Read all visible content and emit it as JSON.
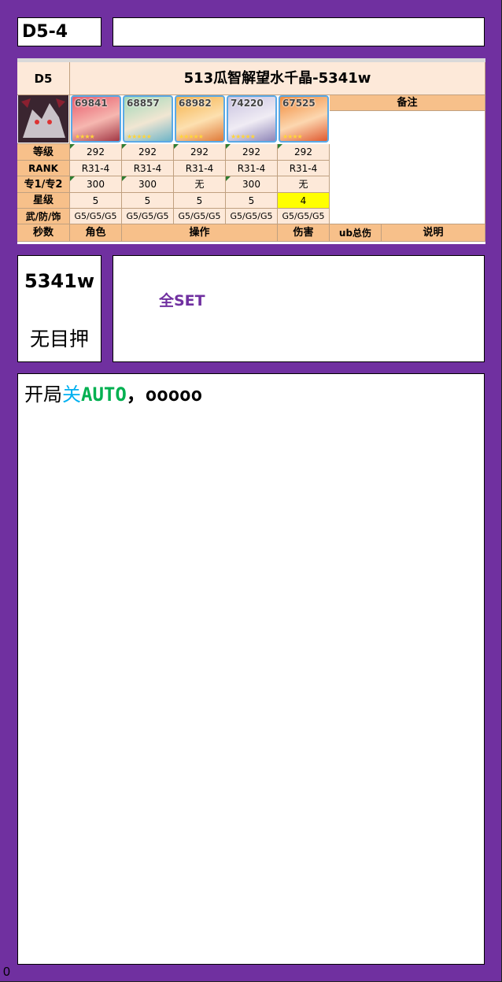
{
  "header": {
    "stage": "D5-4",
    "name_box": ""
  },
  "team": {
    "boss_code": "D5",
    "title": "513瓜智解望水千晶-5341w",
    "remarks_header": "备注",
    "boss_icon": "boss-portrait-icon",
    "characters": [
      {
        "id": "69841",
        "stars": "★★★★",
        "level": "292",
        "rank": "R31-4",
        "ex": "300",
        "star": "5",
        "gear": "G5/G5/G5"
      },
      {
        "id": "68857",
        "stars": "★★★★★",
        "level": "292",
        "rank": "R31-4",
        "ex": "300",
        "star": "5",
        "gear": "G5/G5/G5"
      },
      {
        "id": "68982",
        "stars": "★★★★★",
        "level": "292",
        "rank": "R31-4",
        "ex": "无",
        "star": "5",
        "gear": "G5/G5/G5"
      },
      {
        "id": "74220",
        "stars": "★★★★★",
        "level": "292",
        "rank": "R31-4",
        "ex": "300",
        "star": "5",
        "gear": "G5/G5/G5"
      },
      {
        "id": "67525",
        "stars": "★★★★",
        "level": "292",
        "rank": "R31-4",
        "ex": "无",
        "star": "4",
        "gear": "G5/G5/G5"
      }
    ],
    "row_labels": {
      "level": "等级",
      "rank": "RANK",
      "ex": "专1/专2",
      "star": "星级",
      "gear": "武/防/饰"
    },
    "footer": {
      "seconds": "秒数",
      "role": "角色",
      "action": "操作",
      "damage": "伤害",
      "ub_total": "ub总伤",
      "notes": "说明"
    },
    "highlight_color": "#ffff00"
  },
  "damage": {
    "value": "5341w",
    "note": "无目押"
  },
  "set": {
    "text": "全SET"
  },
  "ops": {
    "prefix": "开局",
    "off": "关",
    "auto": "AUTO",
    "comma": "，",
    "rest": "ooooo"
  },
  "corner": "0"
}
